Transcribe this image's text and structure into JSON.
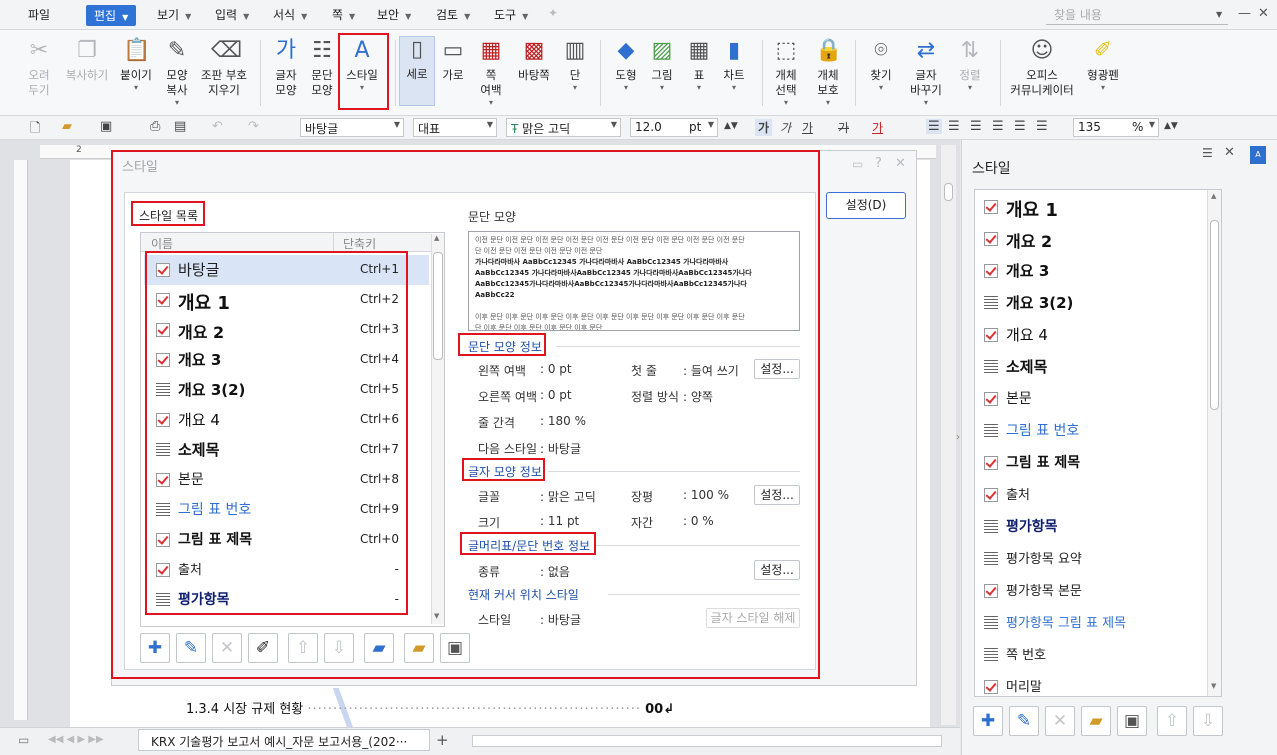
{
  "menu": {
    "items": [
      "파일",
      "편집",
      "보기",
      "입력",
      "서식",
      "쪽",
      "보안",
      "검토",
      "도구"
    ],
    "search_placeholder": "찾을 내용"
  },
  "ribbon": {
    "buttons": [
      {
        "id": "cut",
        "line1": "오려",
        "line2": "두기",
        "icon": "scissors-icon",
        "disabled": true
      },
      {
        "id": "copy",
        "line1": "복사하기",
        "line2": "",
        "icon": "copy-icon",
        "disabled": true
      },
      {
        "id": "paste",
        "line1": "붙이기",
        "line2": "",
        "icon": "clipboard-icon",
        "disabled": false
      },
      {
        "id": "format-copy",
        "line1": "모양",
        "line2": "복사",
        "icon": "brush-icon",
        "disabled": false
      },
      {
        "id": "remove-format",
        "line1": "조판 부호",
        "line2": "지우기",
        "icon": "eraser-icon",
        "disabled": false
      },
      {
        "id": "char-shape",
        "line1": "글자",
        "line2": "모양",
        "icon": "char-shape-icon",
        "disabled": false
      },
      {
        "id": "para-shape",
        "line1": "문단",
        "line2": "모양",
        "icon": "para-shape-icon",
        "disabled": false
      },
      {
        "id": "style",
        "line1": "스타일",
        "line2": "",
        "icon": "style-icon",
        "disabled": false
      },
      {
        "id": "portrait",
        "line1": "세로",
        "line2": "",
        "icon": "portrait-icon",
        "disabled": false
      },
      {
        "id": "landscape",
        "line1": "가로",
        "line2": "",
        "icon": "landscape-icon",
        "disabled": false
      },
      {
        "id": "margin",
        "line1": "쪽",
        "line2": "여백",
        "icon": "margin-icon",
        "disabled": false
      },
      {
        "id": "bg",
        "line1": "바탕쪽",
        "line2": "",
        "icon": "background-icon",
        "disabled": false
      },
      {
        "id": "column",
        "line1": "단",
        "line2": "",
        "icon": "column-icon",
        "disabled": false
      },
      {
        "id": "shape",
        "line1": "도형",
        "line2": "",
        "icon": "shape-icon",
        "disabled": false
      },
      {
        "id": "picture",
        "line1": "그림",
        "line2": "",
        "icon": "picture-icon",
        "disabled": false
      },
      {
        "id": "table",
        "line1": "표",
        "line2": "",
        "icon": "table-icon",
        "disabled": false
      },
      {
        "id": "chart",
        "line1": "차트",
        "line2": "",
        "icon": "chart-icon",
        "disabled": false
      },
      {
        "id": "obj-select",
        "line1": "개체",
        "line2": "선택",
        "icon": "select-icon",
        "disabled": false
      },
      {
        "id": "obj-protect",
        "line1": "개체",
        "line2": "보호",
        "icon": "lock-icon",
        "disabled": false
      },
      {
        "id": "find",
        "line1": "찾기",
        "line2": "",
        "icon": "binoculars-icon",
        "disabled": false
      },
      {
        "id": "replace",
        "line1": "글자",
        "line2": "바꾸기",
        "icon": "replace-icon",
        "disabled": false
      },
      {
        "id": "sort",
        "line1": "정렬",
        "line2": "",
        "icon": "sort-icon",
        "disabled": true
      },
      {
        "id": "community",
        "line1": "오피스",
        "line2": "커뮤니케이터",
        "icon": "chat-icon",
        "disabled": false
      },
      {
        "id": "highlighter",
        "line1": "형광펜",
        "line2": "",
        "icon": "highlighter-icon",
        "disabled": false
      }
    ]
  },
  "toolbar2": {
    "style_value": "바탕글",
    "lang_value": "대표",
    "font_value": "맑은 고딕",
    "size_value": "12.0",
    "size_unit": "pt",
    "zoom_value": "135",
    "zoom_unit": "%",
    "bold_label": "가",
    "italic_label": "가",
    "underline_label": "가",
    "strike_label": "가",
    "color_label": "가"
  },
  "ruler": {
    "mark": "2"
  },
  "document": {
    "toc_entry": "1.3.4  시장  규제  현황",
    "toc_page": "00↲"
  },
  "statusbar": {
    "doc_tab": "KRX 기술평가 보고서 예시_자문 보고서용_(202···"
  },
  "dialog": {
    "title": "스타일",
    "list_title": "스타일 목록",
    "col_name": "이름",
    "col_shortcut": "단축키",
    "settings_button": "설정(D)",
    "styles": [
      {
        "name": "바탕글",
        "shortcut": "Ctrl+1",
        "icon": "check",
        "selected": true,
        "weight": "normal",
        "size": 15,
        "color": "#222222"
      },
      {
        "name": "개요 1",
        "shortcut": "Ctrl+2",
        "icon": "check",
        "selected": false,
        "weight": "bold",
        "size": 18,
        "color": "#111111"
      },
      {
        "name": "개요 2",
        "shortcut": "Ctrl+3",
        "icon": "check",
        "selected": false,
        "weight": "bold",
        "size": 16,
        "color": "#111111"
      },
      {
        "name": "개요 3",
        "shortcut": "Ctrl+4",
        "icon": "check",
        "selected": false,
        "weight": "bold",
        "size": 15,
        "color": "#111111"
      },
      {
        "name": "개요 3(2)",
        "shortcut": "Ctrl+5",
        "icon": "lines",
        "selected": false,
        "weight": "bold",
        "size": 15,
        "color": "#111111"
      },
      {
        "name": "개요 4",
        "shortcut": "Ctrl+6",
        "icon": "check",
        "selected": false,
        "weight": "normal",
        "size": 15,
        "color": "#111111"
      },
      {
        "name": "소제목",
        "shortcut": "Ctrl+7",
        "icon": "lines",
        "selected": false,
        "weight": "bold",
        "size": 15,
        "color": "#111111"
      },
      {
        "name": "본문",
        "shortcut": "Ctrl+8",
        "icon": "check",
        "selected": false,
        "weight": "normal",
        "size": 14,
        "color": "#222222"
      },
      {
        "name": "그림 표 번호",
        "shortcut": "Ctrl+9",
        "icon": "lines",
        "selected": false,
        "weight": "normal",
        "size": 14,
        "color": "#2f6fd0"
      },
      {
        "name": "그림 표 제목",
        "shortcut": "Ctrl+0",
        "icon": "check",
        "selected": false,
        "weight": "bold",
        "size": 14,
        "color": "#111111"
      },
      {
        "name": "출처",
        "shortcut": "-",
        "icon": "check",
        "selected": false,
        "weight": "normal",
        "size": 13,
        "color": "#222222"
      },
      {
        "name": "평가항목",
        "shortcut": "-",
        "icon": "lines",
        "selected": false,
        "weight": "bold",
        "size": 14,
        "color": "#10206e"
      },
      {
        "name": "평가항목 요약",
        "shortcut": "",
        "icon": "lines",
        "selected": false,
        "weight": "normal",
        "size": 13,
        "color": "#222222"
      }
    ],
    "para_preview_label": "문단 모양",
    "preview_lines": [
      "이전 문단 이전 문단 이전 문단 이전 문단 이전 문단 이전 문단 이전 문단 이전 문단 이전 문단",
      "단 이전 문단 이전 문단 이전 문단 이전 문단",
      "가나다라마바사 AaBbCc12345  가나다라마바사 AaBbCc12345  가나다라마바사",
      "AaBbCc12345 가나다라마바사AaBbCc12345 가나다라마바사AaBbCc12345가나다",
      "AaBbCc12345가나다라마바사AaBbCc12345가나다라마바사AaBbCc12345가나다",
      "AaBbCc22",
      "",
      "이후 문단 이후 문단 이후 문단 이후 문단 이후 문단 이후 문단 이후 문단 이후 문단 이후 문단",
      "단 이후 문단 이후 문단 이후 문단 이후 문단"
    ],
    "para_info_title": "문단 모양 정보",
    "left_margin_label": "왼쪽 여백",
    "left_margin_value": ": 0 pt",
    "first_line_label": "첫 줄",
    "first_line_value": ": 들여 쓰기",
    "right_margin_label": "오른쪽 여백",
    "right_margin_value": ": 0 pt",
    "align_label": "정렬 방식",
    "align_value": ": 양쪽",
    "line_spacing_label": "줄 간격",
    "line_spacing_value": ": 180 %",
    "next_style_label": "다음 스타일",
    "next_style_value": ": 바탕글",
    "char_info_title": "글자 모양 정보",
    "font_label": "글꼴",
    "font_value": ": 맑은 고딕",
    "ratio_label": "장평",
    "ratio_value": ": 100 %",
    "size_label": "크기",
    "size_value": ": 11 pt",
    "spacing_label": "자간",
    "spacing_value": ": 0 %",
    "bullet_info_title": "글머리표/문단 번호 정보",
    "type_label": "종류",
    "type_value": ": 없음",
    "cursor_style_title": "현재 커서 위치 스타일",
    "cursor_style_label": "스타일",
    "cursor_style_value": ": 바탕글",
    "clear_char_style": "글자 스타일 해제",
    "settings_small": "설정..."
  },
  "panel": {
    "title": "스타일",
    "styles": [
      {
        "name": "개요 1",
        "icon": "check",
        "weight": "bold",
        "size": 18,
        "color": "#111111"
      },
      {
        "name": "개요 2",
        "icon": "check",
        "weight": "bold",
        "size": 16,
        "color": "#111111"
      },
      {
        "name": "개요 3",
        "icon": "check",
        "weight": "bold",
        "size": 15,
        "color": "#111111"
      },
      {
        "name": "개요 3(2)",
        "icon": "lines",
        "weight": "bold",
        "size": 15,
        "color": "#111111"
      },
      {
        "name": "개요 4",
        "icon": "check",
        "weight": "normal",
        "size": 15,
        "color": "#111111"
      },
      {
        "name": "소제목",
        "icon": "lines",
        "weight": "bold",
        "size": 15,
        "color": "#111111"
      },
      {
        "name": "본문",
        "icon": "check",
        "weight": "normal",
        "size": 14,
        "color": "#222222"
      },
      {
        "name": "그림 표 번호",
        "icon": "lines",
        "weight": "normal",
        "size": 14,
        "color": "#2f6fd0"
      },
      {
        "name": "그림 표 제목",
        "icon": "check",
        "weight": "bold",
        "size": 14,
        "color": "#111111"
      },
      {
        "name": "출처",
        "icon": "check",
        "weight": "normal",
        "size": 13,
        "color": "#222222"
      },
      {
        "name": "평가항목",
        "icon": "lines",
        "weight": "bold",
        "size": 14,
        "color": "#10206e"
      },
      {
        "name": "평가항목 요약",
        "icon": "lines",
        "weight": "normal",
        "size": 13,
        "color": "#222222"
      },
      {
        "name": "평가항목 본문",
        "icon": "check",
        "weight": "normal",
        "size": 13,
        "color": "#222222"
      },
      {
        "name": "평가항목 그림 표 제목",
        "icon": "lines",
        "weight": "normal",
        "size": 13,
        "color": "#2f6fd0"
      },
      {
        "name": "쪽 번호",
        "icon": "lines",
        "weight": "normal",
        "size": 13,
        "color": "#222222"
      },
      {
        "name": "머리말",
        "icon": "check",
        "weight": "normal",
        "size": 13,
        "color": "#222222"
      }
    ]
  }
}
